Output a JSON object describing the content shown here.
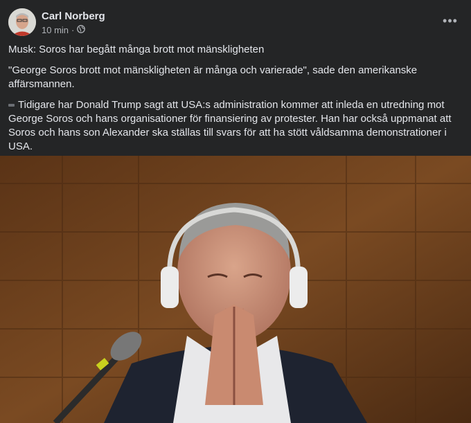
{
  "post": {
    "author": "Carl Norberg",
    "time": "10 min",
    "separator": "·",
    "privacy_icon": "globe-icon",
    "more_icon": "more-options-icon",
    "more_label": "•••",
    "paragraphs": [
      "Musk: Soros har begått många brott mot mänskligheten",
      "\"George Soros brott mot mänskligheten är många och varierade\", sade den amerikanske affärsmannen.",
      "Tidigare har Donald Trump sagt att USA:s administration kommer att inleda en utredning mot George Soros och hans organisationer för finansiering av protester. Han har också uppmanat att Soros och hans son Alexander ska ställas till svars för att ha stött våldsamma demonstrationer i USA."
    ]
  },
  "colors": {
    "background": "#242526",
    "text": "#e4e6eb",
    "secondary_text": "#b0b3b8"
  }
}
